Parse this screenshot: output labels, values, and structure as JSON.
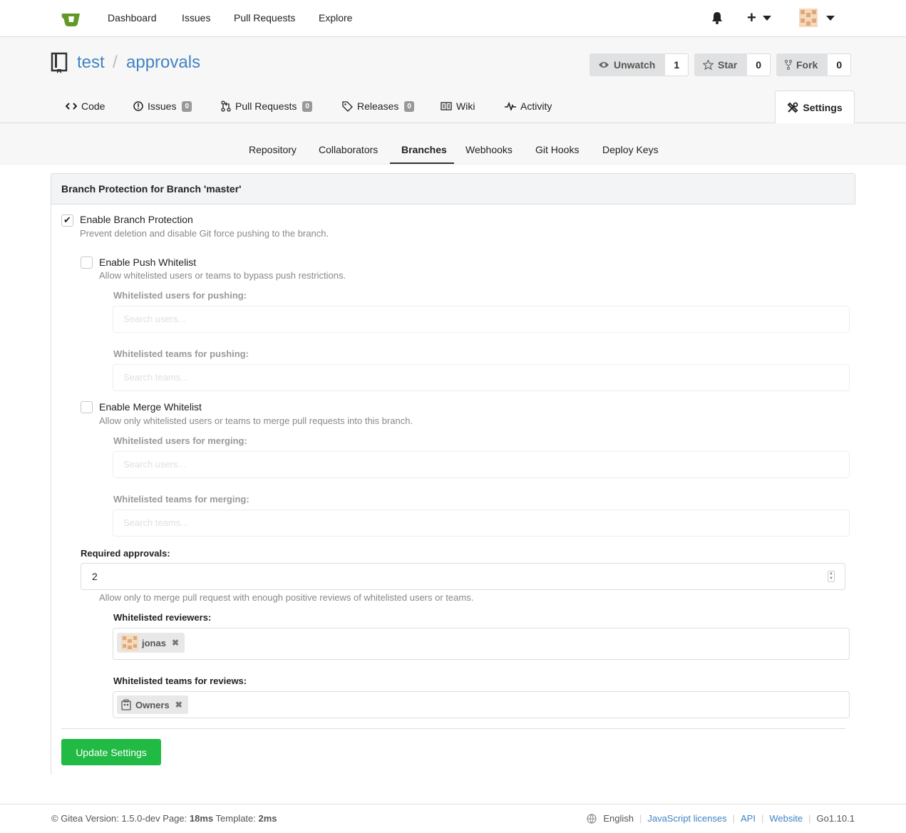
{
  "topnav": {
    "links": [
      "Dashboard",
      "Issues",
      "Pull Requests",
      "Explore"
    ],
    "plus": "+"
  },
  "repo": {
    "owner": "test",
    "separator": "/",
    "name": "approvals",
    "unwatch_label": "Unwatch",
    "unwatch_count": "1",
    "star_label": "Star",
    "star_count": "0",
    "fork_label": "Fork",
    "fork_count": "0"
  },
  "tabs": [
    {
      "label": "Code",
      "icon": "code-icon"
    },
    {
      "label": "Issues",
      "badge": "0",
      "icon": "issue-icon"
    },
    {
      "label": "Pull Requests",
      "badge": "0",
      "icon": "pull-request-icon"
    },
    {
      "label": "Releases",
      "badge": "0",
      "icon": "tag-icon"
    },
    {
      "label": "Wiki",
      "icon": "book-icon"
    },
    {
      "label": "Activity",
      "icon": "pulse-icon"
    },
    {
      "label": "Settings",
      "icon": "tools-icon",
      "active": true
    }
  ],
  "subnav": [
    "Repository",
    "Collaborators",
    "Branches",
    "Webhooks",
    "Git Hooks",
    "Deploy Keys"
  ],
  "subnav_active": "Branches",
  "panel": {
    "title": "Branch Protection for Branch 'master'",
    "enable_protection": {
      "label": "Enable Branch Protection",
      "help": "Prevent deletion and disable Git force pushing to the branch.",
      "checked": true
    },
    "push_whitelist": {
      "label": "Enable Push Whitelist",
      "help": "Allow whitelisted users or teams to bypass push restrictions.",
      "checked": false
    },
    "push_users_label": "Whitelisted users for pushing:",
    "push_users_placeholder": "Search users...",
    "push_teams_label": "Whitelisted teams for pushing:",
    "push_teams_placeholder": "Search teams...",
    "merge_whitelist": {
      "label": "Enable Merge Whitelist",
      "help": "Allow only whitelisted users or teams to merge pull requests into this branch.",
      "checked": false
    },
    "merge_users_label": "Whitelisted users for merging:",
    "merge_users_placeholder": "Search users...",
    "merge_teams_label": "Whitelisted teams for merging:",
    "merge_teams_placeholder": "Search teams...",
    "required_approvals_label": "Required approvals:",
    "required_approvals_value": "2",
    "required_approvals_help": "Allow only to merge pull request with enough positive reviews of whitelisted users or teams.",
    "reviewers_label": "Whitelisted reviewers:",
    "reviewers": [
      "jonas"
    ],
    "review_teams_label": "Whitelisted teams for reviews:",
    "review_teams": [
      "Owners"
    ],
    "update_button": "Update Settings"
  },
  "footer": {
    "version_prefix": "© Gitea Version: 1.5.0-dev Page:",
    "page_time": "18ms",
    "template_prefix": "Template:",
    "template_time": "2ms",
    "language": "English",
    "links": [
      "JavaScript licenses",
      "API",
      "Website"
    ],
    "go_version": "Go1.10.1"
  },
  "colors": {
    "link": "#4183c4",
    "primary_button": "#21ba45"
  }
}
